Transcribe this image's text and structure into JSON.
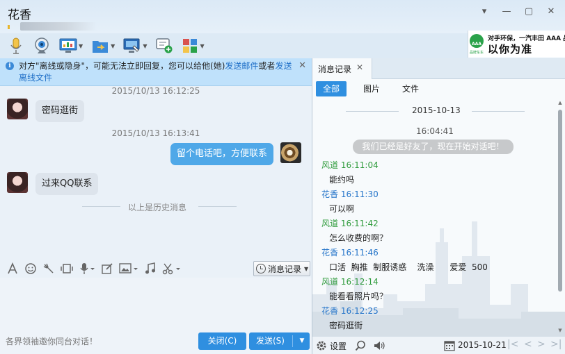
{
  "window": {
    "title": "花香",
    "minimize_glyph": "▾",
    "min_glyph": "—",
    "max_glyph": "▢",
    "close_glyph": "✕"
  },
  "toolbar": {
    "items": [
      {
        "icon": "microphone-icon"
      },
      {
        "icon": "webcam-icon"
      },
      {
        "icon": "remote-desktop-icon"
      },
      {
        "icon": "send-file-icon"
      },
      {
        "icon": "screen-share-icon"
      },
      {
        "icon": "add-chat-icon"
      },
      {
        "icon": "apps-icon"
      }
    ]
  },
  "ad": {
    "logo_text": "AAA",
    "logo_sub": "品牌车车",
    "line1": "对手环保，一汽丰田 AAA 品牌",
    "line2": "以你为准"
  },
  "notice": {
    "icon": "i",
    "text_before": "对方\"离线或隐身\"，可能无法立即回复，您可以给他(她)",
    "link1": "发送邮件",
    "text_middle": "或者",
    "link2": "发送离线文件"
  },
  "chat": {
    "messages": [
      {
        "timestamp": "2015/10/13 16:12:25",
        "side": "left",
        "text": "密码逛街"
      },
      {
        "timestamp": "2015/10/13 16:13:41",
        "side": "right",
        "text": "留个电话吧，方便联系"
      },
      {
        "timestamp": "",
        "side": "left",
        "text": "过来QQ联系"
      }
    ],
    "history_divider": "以上是历史消息"
  },
  "input_toolbar": {
    "icons": [
      "font-icon",
      "emoji-icon",
      "shake-icon",
      "gif-icon",
      "voice-icon",
      "edit-icon",
      "image-icon",
      "music-icon",
      "screenshot-icon"
    ],
    "history_label": "消息记录"
  },
  "footer": {
    "invite_text": "各界领袖邀你同台对话！",
    "close_label": "关闭(C)",
    "send_label": "发送(S)"
  },
  "history_panel": {
    "tab_label": "消息记录",
    "filters": [
      "全部",
      "图片",
      "文件"
    ],
    "active_filter": "全部",
    "date": "2015-10-13",
    "first_time": "16:04:41",
    "system_message": "我们已经是好友了，现在开始对话吧！",
    "entries": [
      {
        "sender": "风道",
        "time": "16:11:04",
        "type": "me",
        "text": "能约吗"
      },
      {
        "sender": "花香",
        "time": "16:11:30",
        "type": "other",
        "text": "可以啊"
      },
      {
        "sender": "风道",
        "time": "16:11:42",
        "type": "me",
        "text": "怎么收费的啊？"
      },
      {
        "sender": "花香",
        "time": "16:11:46",
        "type": "other",
        "text": "口活  胸推  制服诱惑    洗澡      爱爱  500"
      },
      {
        "sender": "风道",
        "time": "16:12:14",
        "type": "me",
        "text": "能看看照片吗？"
      },
      {
        "sender": "花香",
        "time": "16:12:25",
        "type": "other",
        "text": "密码逛街"
      }
    ],
    "settings_label": "设置",
    "footer_date": "2015-10-21"
  },
  "colors": {
    "accent": "#2f8fe0",
    "my_name": "#2f9b3c",
    "other_name": "#2474c9",
    "notice_bg": "#bfe1fb"
  }
}
